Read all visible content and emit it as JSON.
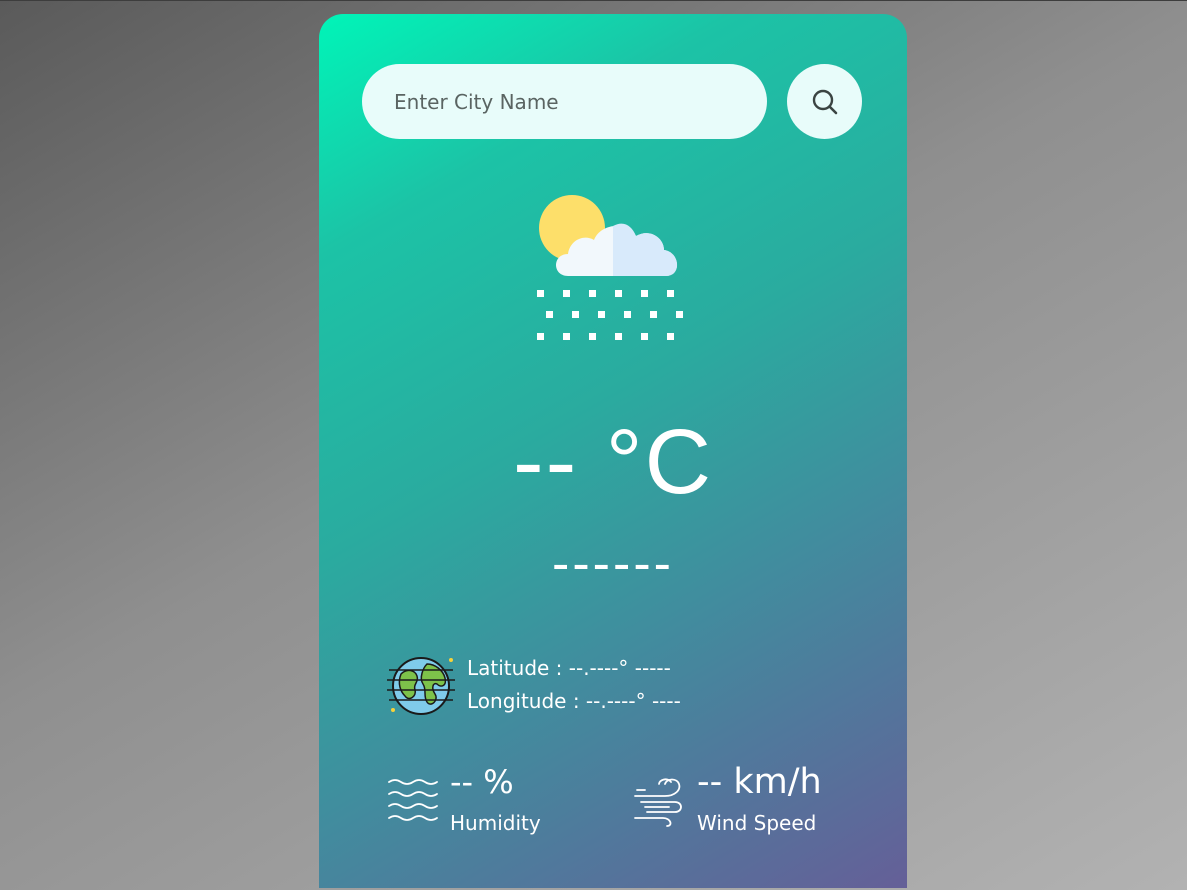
{
  "search": {
    "placeholder": "Enter City Name",
    "value": ""
  },
  "icons": {
    "search": "search-icon",
    "weather": "snow-cloud-sun-icon",
    "globe": "globe-icon",
    "humidity": "waves-icon",
    "wind": "wind-icon"
  },
  "weather": {
    "temperature": "-- °C",
    "city": "------"
  },
  "location": {
    "latitude": "Latitude : --.----° -----",
    "longitude": "Longitude : --.----° ----"
  },
  "humidity": {
    "value": "-- %",
    "label": "Humidity"
  },
  "wind": {
    "value": "-- km/h",
    "label": "Wind Speed"
  },
  "colors": {
    "card_top": "#00f5b8",
    "card_mid": "#2aab9f",
    "card_bottom": "#655f98",
    "input_bg": "#e8fcfa",
    "text": "#ffffff"
  }
}
